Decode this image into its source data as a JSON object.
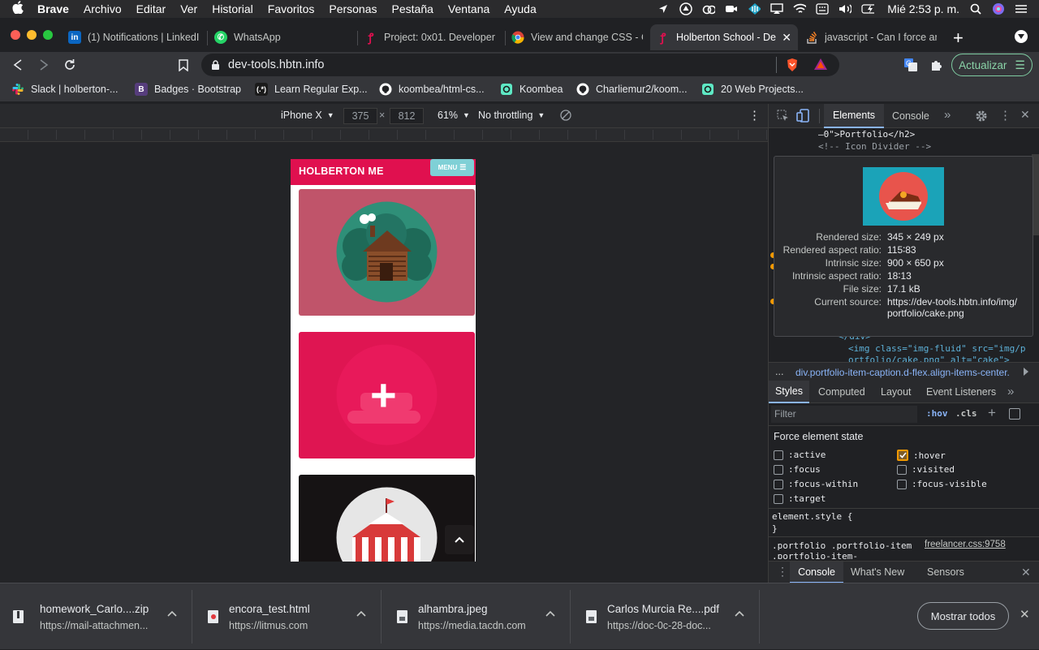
{
  "menubar": {
    "app": "Brave",
    "items": [
      "Archivo",
      "Editar",
      "Ver",
      "Historial",
      "Favoritos",
      "Personas",
      "Pestaña",
      "Ventana",
      "Ayuda"
    ],
    "clock": "Mié 2:53 p. m."
  },
  "tabs": [
    {
      "title": "(1) Notifications | LinkedIn",
      "favicon": "linkedin-icon",
      "color": "#0a66c2"
    },
    {
      "title": "WhatsApp",
      "favicon": "whatsapp-icon",
      "color": "#25d366"
    },
    {
      "title": "Project: 0x01. Developer t",
      "favicon": "holberton-icon",
      "color": "#e0104f"
    },
    {
      "title": "View and change CSS - C",
      "favicon": "chrome-icon",
      "color": "#4285f4"
    },
    {
      "title": "Holberton School - De",
      "favicon": "holberton-icon",
      "color": "#e0104f",
      "active": true
    },
    {
      "title": "javascript - Can I force an",
      "favicon": "stackoverflow-icon",
      "color": "#f48024"
    }
  ],
  "toolbar": {
    "url": "dev-tools.hbtn.info",
    "update_label": "Actualizar"
  },
  "bookmarks": [
    {
      "label": "Slack | holberton-...",
      "icon": "slack-icon"
    },
    {
      "label": "Badges · Bootstrap",
      "icon": "bootstrap-icon"
    },
    {
      "label": "Learn Regular Exp...",
      "icon": "regex-icon"
    },
    {
      "label": "koombea/html-cs...",
      "icon": "github-icon"
    },
    {
      "label": "Koombea",
      "icon": "koombea-icon"
    },
    {
      "label": "Charliemur2/koom...",
      "icon": "github-icon"
    },
    {
      "label": "20 Web Projects...",
      "icon": "globe-icon"
    }
  ],
  "device_toolbar": {
    "device": "iPhone X",
    "width": "375",
    "height": "812",
    "zoom": "61%",
    "throttling": "No throttling"
  },
  "phone": {
    "brand": "HOLBERTON ME",
    "menu_label": "MENU",
    "cards": [
      {
        "bg": "#c0546a",
        "icon": "cabin-icon"
      },
      {
        "bg": "#df1552",
        "icon": "plus-icon",
        "hover": true
      },
      {
        "bg": "#161314",
        "icon": "circus-tent-icon"
      }
    ]
  },
  "devtools": {
    "tabs": [
      "Elements",
      "Console"
    ],
    "code_lines": [
      "–0\">Portfolio</h2>",
      "<!-- Icon Divider -->"
    ],
    "code_img_line1": "<img class=\"img-fluid\" src=\"img/p",
    "code_img_line2": "ortfolio/cake.png\" alt=\"cake\">",
    "code_fragment": "</div>",
    "breadcrumb_more": "...",
    "breadcrumb": "div.portfolio-item-caption.d-flex.align-items-center.",
    "tooltip": {
      "rows": [
        {
          "k": "Rendered size:",
          "v": "345 × 249 px"
        },
        {
          "k": "Rendered aspect ratio:",
          "v": "115∶83"
        },
        {
          "k": "Intrinsic size:",
          "v": "900 × 650 px"
        },
        {
          "k": "Intrinsic aspect ratio:",
          "v": "18∶13"
        },
        {
          "k": "File size:",
          "v": "17.1 kB"
        },
        {
          "k": "Current source:",
          "v": "https://dev-tools.hbtn.info/img/",
          "v2": "portfolio/cake.png"
        }
      ]
    },
    "style_tabs": [
      "Styles",
      "Computed",
      "Layout",
      "Event Listeners"
    ],
    "filter_placeholder": "Filter",
    "hov_label": ":hov",
    "cls_label": ".cls",
    "force_state_title": "Force element state",
    "states_left": [
      ":active",
      ":focus",
      ":focus-within",
      ":target"
    ],
    "states_right": [
      ":hover",
      ":visited",
      ":focus-visible"
    ],
    "element_style": "element.style {",
    "element_style_close": "}",
    "rule_selector": ".portfolio .portfolio-item",
    "rule_selector2": ".portfolio-item-",
    "rule_source": "freelancer.css:9758",
    "drawer_tabs": [
      "Console",
      "What's New",
      "Sensors"
    ]
  },
  "downloads": {
    "items": [
      {
        "name": "homework_Carlo....zip",
        "source": "https://mail-attachmen..."
      },
      {
        "name": "encora_test.html",
        "source": "https://litmus.com"
      },
      {
        "name": "alhambra.jpeg",
        "source": "https://media.tacdn.com"
      },
      {
        "name": "Carlos Murcia Re....pdf",
        "source": "https://doc-0c-28-doc..."
      }
    ],
    "show_all_label": "Mostrar todos"
  }
}
